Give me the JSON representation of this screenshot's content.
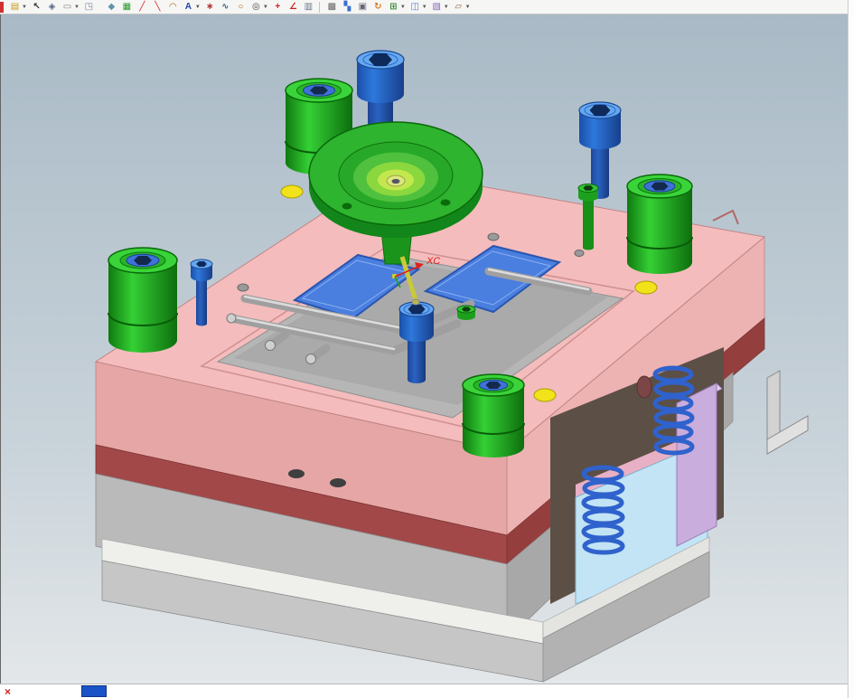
{
  "toolbar": {
    "items": [
      {
        "name": "open",
        "glyph": "▤",
        "color": "#c89a18",
        "dd": true
      },
      {
        "name": "select-cursor",
        "glyph": "↖",
        "color": "#333333",
        "dd": false
      },
      {
        "name": "pan",
        "glyph": "◈",
        "color": "#556688",
        "dd": false
      },
      {
        "name": "marquee-select",
        "glyph": "▭",
        "color": "#888888",
        "dd": true
      },
      {
        "name": "view-orient",
        "glyph": "◳",
        "color": "#7a8aa0",
        "dd": false
      },
      {
        "name": "shaded-display",
        "glyph": "◆",
        "color": "#5f93aa",
        "dd": false,
        "gap": true
      },
      {
        "name": "snap-point",
        "glyph": "▦",
        "color": "#2a9a2a",
        "dd": false
      },
      {
        "name": "line",
        "glyph": "╱",
        "color": "#cc2222",
        "dd": false
      },
      {
        "name": "profile",
        "glyph": "╲",
        "color": "#cc2222",
        "dd": false
      },
      {
        "name": "arc",
        "glyph": "◠",
        "color": "#b06010",
        "dd": false
      },
      {
        "name": "annotation",
        "glyph": "A",
        "color": "#2244aa",
        "dd": true
      },
      {
        "name": "point",
        "glyph": "∗",
        "color": "#b03030",
        "dd": false
      },
      {
        "name": "spline",
        "glyph": "∿",
        "color": "#336688",
        "dd": false
      },
      {
        "name": "circle",
        "glyph": "○",
        "color": "#b06010",
        "dd": false
      },
      {
        "name": "point-on-curve",
        "glyph": "◎",
        "color": "#444444",
        "dd": true
      },
      {
        "name": "plus",
        "glyph": "+",
        "color": "#cc2222",
        "dd": false
      },
      {
        "name": "measure-angle",
        "glyph": "∠",
        "color": "#cc2222",
        "dd": false
      },
      {
        "name": "grab-hand",
        "glyph": "▥",
        "color": "#667788",
        "dd": false
      },
      {
        "name": "info-table",
        "glyph": "▩",
        "color": "#666666",
        "dd": false,
        "sep": true
      },
      {
        "name": "window-layout",
        "glyph": "▚",
        "color": "#3a6fd0",
        "dd": false
      },
      {
        "name": "image-capture",
        "glyph": "▣",
        "color": "#666677",
        "dd": false
      },
      {
        "name": "refresh-fit",
        "glyph": "↻",
        "color": "#e07818",
        "dd": false
      },
      {
        "name": "grid-display",
        "glyph": "⊞",
        "color": "#3a8a3a",
        "dd": true
      },
      {
        "name": "display-mode",
        "glyph": "◫",
        "color": "#5577cc",
        "dd": true
      },
      {
        "name": "assembly",
        "glyph": "▧",
        "color": "#8866bb",
        "dd": true
      },
      {
        "name": "sketch-edit",
        "glyph": "▱",
        "color": "#996644",
        "dd": true
      }
    ],
    "dropdown_glyph": "▼"
  },
  "viewport": {
    "labels": {
      "xc": "XC"
    },
    "colors": {
      "plate_pink": "#f4bcbc",
      "plate_pink_left": "#e6a6a6",
      "plate_pink_right": "#edb2b2",
      "plate_maroon": "#a24848",
      "base_gray": "#c6c6c6",
      "bushing_green": "#35d035",
      "screw_blue": "#2e78dc",
      "insert_blue": "#4a7fe0",
      "spring_blue": "#2f62cc",
      "ejector_purple": "#c9addc",
      "panel_lightblue": "#c2e4f4",
      "hole_yellow": "#f2e21a"
    }
  },
  "statusbar": {
    "close_glyph": "×"
  }
}
